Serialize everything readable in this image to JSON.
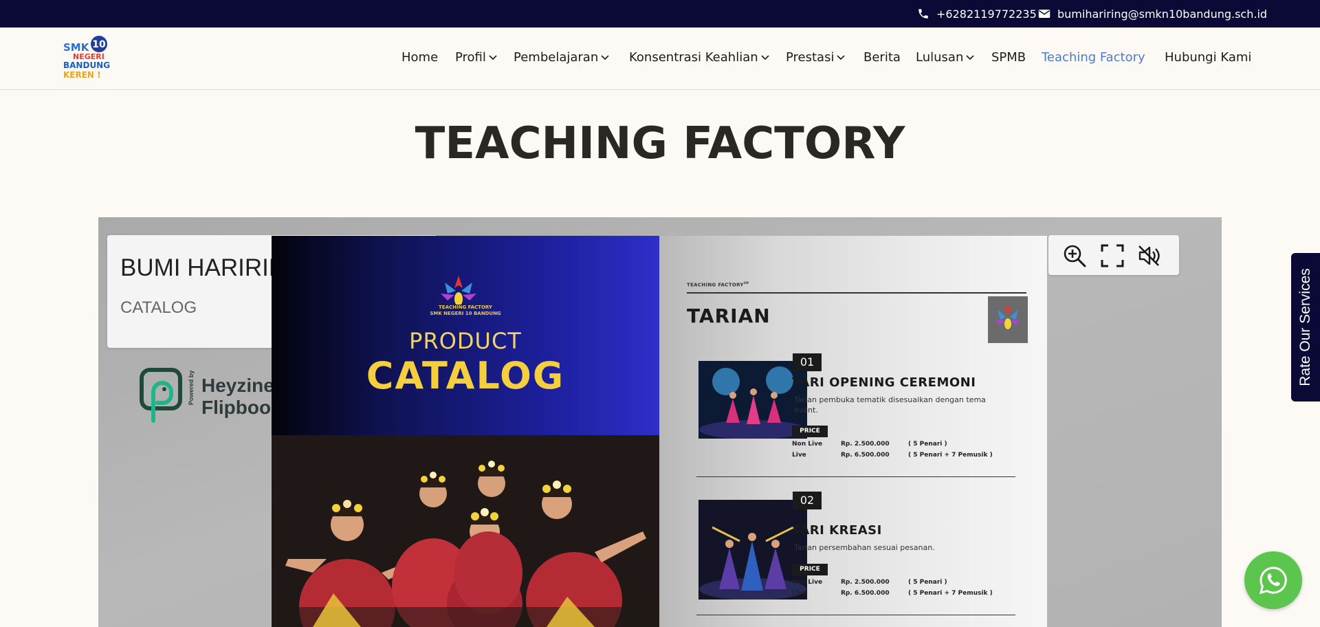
{
  "topbar": {
    "phone": "+6282119772235",
    "email": "bumihariring@smkn10bandung.sch.id",
    "phone_icon": "phone-icon",
    "email_icon": "envelope-icon"
  },
  "logo": {
    "line1": "SMK",
    "number": "10",
    "line2": "NEGERI",
    "line3": "BANDUNG",
    "line4": "KEREN !"
  },
  "nav": {
    "items": [
      {
        "label": "Home",
        "dropdown": false
      },
      {
        "label": "Profil",
        "dropdown": true
      },
      {
        "label": "Pembelajaran",
        "dropdown": true
      },
      {
        "label": "Konsentrasi Keahlian",
        "dropdown": true
      },
      {
        "label": "Prestasi",
        "dropdown": true
      },
      {
        "label": "Berita",
        "dropdown": false
      },
      {
        "label": "Lulusan",
        "dropdown": true
      },
      {
        "label": "SPMB",
        "dropdown": false
      },
      {
        "label": "Teaching Factory",
        "dropdown": false,
        "active": true
      },
      {
        "label": "Hubungi Kami",
        "dropdown": false
      }
    ],
    "active_color": "#4a7ccc"
  },
  "page": {
    "title": "TEACHING FACTORY"
  },
  "flipbook": {
    "info_title": "BUMI HARIRIN",
    "info_subtitle": "CATALOG",
    "powered_by": "Powered by",
    "brand_line1": "Heyzine",
    "brand_line2": "Flipbook",
    "cover": {
      "logo_text_1": "TEACHING FACTORY",
      "logo_text_2": "SMK NEGERI 10 BANDUNG",
      "product": "PRODUCT",
      "catalog": "CATALOG"
    },
    "right_page": {
      "kicker": "TEACHING FACTORY",
      "kicker_sup": "SM",
      "title": "TARIAN",
      "items": [
        {
          "num": "01",
          "title": "TARI OPENING CEREMONI",
          "desc": "Tarian pembuka tematik disesuaikan dengan tema event.",
          "price_label": "PRICE",
          "rows": [
            {
              "type": "Non Live",
              "price": "Rp. 2.500.000",
              "note": "( 5 Penari )"
            },
            {
              "type": "Live",
              "price": "Rp. 6.500.000",
              "note": "( 5 Penari + 7 Pemusik )"
            }
          ]
        },
        {
          "num": "02",
          "title": "TARI KREASI",
          "desc": "Tarian persembahan sesuai pesanan.",
          "price_label": "PRICE",
          "rows": [
            {
              "type": "Non Live",
              "price": "Rp. 2.500.000",
              "note": "( 5 Penari )"
            },
            {
              "type": "Live",
              "price": "Rp. 6.500.000",
              "note": "( 5 Penari + 7 Pemusik )"
            }
          ]
        }
      ]
    },
    "tools": [
      "zoom-in-icon",
      "fullscreen-icon",
      "sound-off-icon"
    ]
  },
  "side_tab": {
    "label": "Rate Our Services"
  },
  "whatsapp": {
    "icon": "whatsapp-icon",
    "color": "#5cc54e"
  }
}
